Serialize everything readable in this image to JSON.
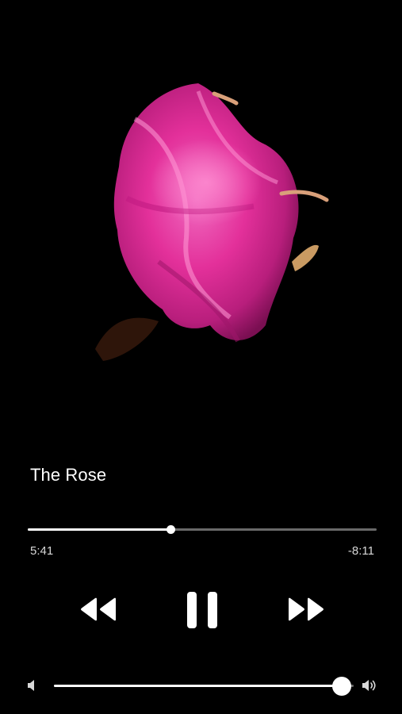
{
  "player": {
    "title": "The Rose",
    "elapsed": "5:41",
    "remaining": "-8:11",
    "progress_fraction": 0.41,
    "volume_fraction": 0.96
  },
  "artwork": {
    "subject": "dancer in flowing pink dress on black background",
    "dress_color": "#e3309a",
    "background_color": "#000000"
  },
  "icons": {
    "rewind": "rewind-icon",
    "pause": "pause-icon",
    "forward": "fast-forward-icon",
    "volume_min": "volume-min-icon",
    "volume_max": "volume-max-icon"
  }
}
